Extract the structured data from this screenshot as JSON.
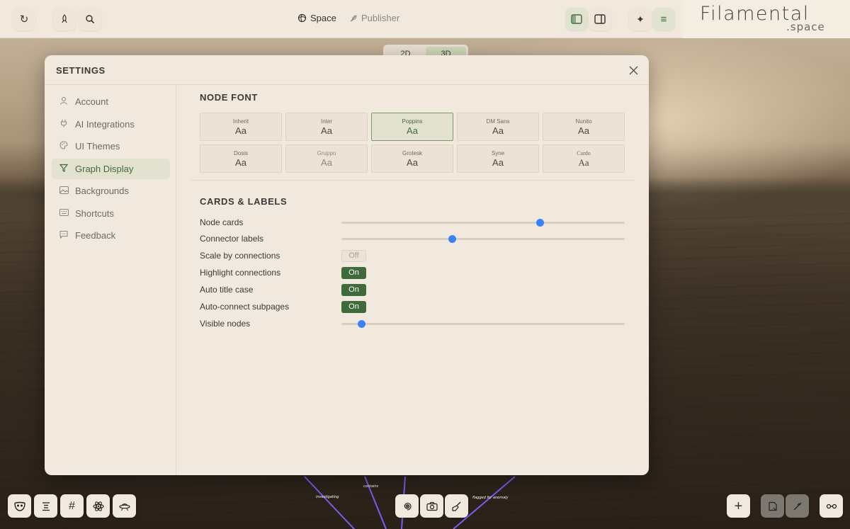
{
  "topbar": {
    "refresh_icon": "refresh-icon",
    "rocket_icon": "rocket-icon",
    "search_icon": "search-icon",
    "tabs": [
      {
        "label": "Space",
        "icon": "space-icon"
      },
      {
        "label": "Publisher",
        "icon": "feather-icon"
      }
    ],
    "right_buttons": [
      "panel-left-icon",
      "panel-right-icon",
      "sparkle-icon",
      "menu-icon"
    ]
  },
  "brand": {
    "title": "Filamental",
    "subtitle": ".space"
  },
  "dimension_toggle": {
    "options": [
      "2D",
      "3D"
    ],
    "selected": "3D"
  },
  "modal": {
    "title": "SETTINGS",
    "sidebar": [
      {
        "label": "Account",
        "icon": "user-icon"
      },
      {
        "label": "AI Integrations",
        "icon": "plug-icon"
      },
      {
        "label": "UI Themes",
        "icon": "palette-icon"
      },
      {
        "label": "Graph Display",
        "icon": "graph-icon",
        "active": true
      },
      {
        "label": "Backgrounds",
        "icon": "image-icon"
      },
      {
        "label": "Shortcuts",
        "icon": "keyboard-icon"
      },
      {
        "label": "Feedback",
        "icon": "message-icon"
      }
    ],
    "node_font": {
      "title": "NODE FONT",
      "fonts": [
        {
          "name": "Inherit",
          "sample": "Aa"
        },
        {
          "name": "Inter",
          "sample": "Aa"
        },
        {
          "name": "Poppins",
          "sample": "Aa",
          "selected": true
        },
        {
          "name": "DM Sans",
          "sample": "Aa"
        },
        {
          "name": "Nunito",
          "sample": "Aa"
        },
        {
          "name": "Dosis",
          "sample": "Aa"
        },
        {
          "name": "Gruppo",
          "sample": "Aa"
        },
        {
          "name": "Grotesk",
          "sample": "Aa"
        },
        {
          "name": "Syne",
          "sample": "Aa"
        },
        {
          "name": "Cardo",
          "sample": "Aa"
        }
      ]
    },
    "cards_labels": {
      "title": "CARDS & LABELS",
      "rows": [
        {
          "label": "Node cards",
          "type": "slider",
          "value": 0.7
        },
        {
          "label": "Connector labels",
          "type": "slider",
          "value": 0.39
        },
        {
          "label": "Scale by connections",
          "type": "toggle",
          "value": "Off"
        },
        {
          "label": "Highlight connections",
          "type": "toggle",
          "value": "On"
        },
        {
          "label": "Auto title case",
          "type": "toggle",
          "value": "On"
        },
        {
          "label": "Auto-connect subpages",
          "type": "toggle",
          "value": "On"
        },
        {
          "label": "Visible nodes",
          "type": "slider",
          "value": 0.07
        }
      ]
    }
  },
  "graph": {
    "edge_labels": [
      "investigating",
      "contains",
      "flagged for anomaly"
    ]
  },
  "bottom_toolbar": {
    "left": [
      "mask-icon",
      "align-icon",
      "hash-icon",
      "atom-icon",
      "ufo-icon"
    ],
    "center": [
      "spiral-icon",
      "camera-icon",
      "broom-icon"
    ],
    "right": [
      "plus-icon",
      "note-icon",
      "line-icon",
      "link-icon"
    ]
  },
  "colors": {
    "accent_green": "#3f6b3a",
    "slider_blue": "#3b82f6",
    "panel_bg": "#f1e9dd",
    "edge_purple": "#7b5cf0"
  }
}
